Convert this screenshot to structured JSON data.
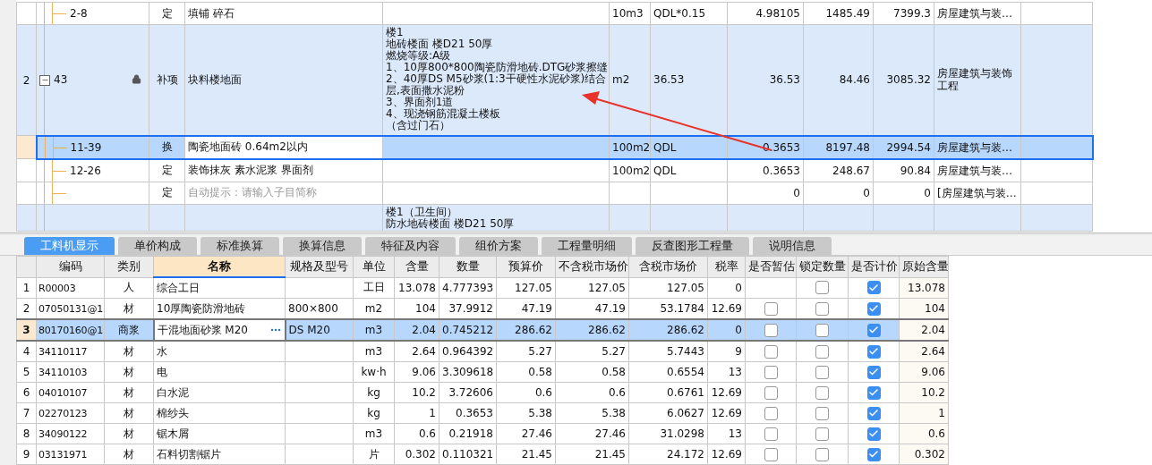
{
  "top_table": {
    "rows": [
      {
        "children": [
          {
            "code": "2-8",
            "type": "定",
            "name": "填铺 碎石",
            "unit": "10m3",
            "expression": "QDL*0.15",
            "quantity": "4.98105",
            "unit_price": "1485.49",
            "total": "7399.3",
            "specialty": "房屋建筑与装…",
            "selected": false
          }
        ]
      },
      {
        "seq": "2",
        "code": "43",
        "expanded": true,
        "locked": true,
        "type": "补项",
        "name": "块料楼地面",
        "features": [
          "楼1",
          "地砖楼面 楼D21 50厚",
          "燃烧等级:A级",
          "1、10厚800*800陶瓷防滑地砖.DTG砂浆擦缝",
          "2、40厚DS M5砂浆(1:3干硬性水泥砂浆)结合",
          "层,表面撒水泥粉",
          "3、界面剂1道",
          "4、现浇钢筋混凝土楼板",
          "（含过门石）"
        ],
        "unit": "m2",
        "expression": "36.53",
        "quantity": "36.53",
        "unit_price": "84.46",
        "total": "3085.32",
        "specialty": "房屋建筑与装饰工程",
        "selected": false,
        "children": [
          {
            "code": "11-39",
            "type": "换",
            "name": "陶瓷地面砖 0.64m2以内",
            "unit": "100m2",
            "expression": "QDL",
            "quantity": "0.3653",
            "unit_price": "8197.48",
            "total": "2994.54",
            "specialty": "房屋建筑与装…",
            "selected": true
          },
          {
            "code": "12-26",
            "type": "定",
            "name": "装饰抹灰 素水泥浆 界面剂",
            "unit": "100m2",
            "expression": "QDL",
            "quantity": "0.3653",
            "unit_price": "248.67",
            "total": "90.84",
            "specialty": "房屋建筑与装…",
            "selected": false
          },
          {
            "type": "定",
            "placeholder": "自动提示：请输入子目简称",
            "quantity": "0",
            "unit_price": "0",
            "total": "0",
            "specialty": "[房屋建筑与装…",
            "selected": false
          }
        ]
      },
      {
        "features": [
          "楼1（卫生间）",
          "防水地砖楼面 楼D21 50厚"
        ],
        "selected": false
      }
    ]
  },
  "tabs": [
    {
      "label": "工料机显示",
      "selected": true
    },
    {
      "label": "单价构成",
      "selected": false
    },
    {
      "label": "标准换算",
      "selected": false
    },
    {
      "label": "换算信息",
      "selected": false
    },
    {
      "label": "特征及内容",
      "selected": false
    },
    {
      "label": "组价方案",
      "selected": false
    },
    {
      "label": "工程量明细",
      "selected": false
    },
    {
      "label": "反查图形工程量",
      "selected": false
    },
    {
      "label": "说明信息",
      "selected": false
    }
  ],
  "resource_table": {
    "columns": [
      {
        "label": "编码",
        "selected": false
      },
      {
        "label": "类别",
        "selected": false
      },
      {
        "label": "名称",
        "selected": true
      },
      {
        "label": "规格及型号",
        "selected": false
      },
      {
        "label": "单位",
        "selected": false
      },
      {
        "label": "含量",
        "selected": false
      },
      {
        "label": "数量",
        "selected": false
      },
      {
        "label": "预算价",
        "selected": false
      },
      {
        "label": "不含税市场价",
        "selected": false
      },
      {
        "label": "含税市场价",
        "selected": false
      },
      {
        "label": "税率",
        "selected": false
      },
      {
        "label": "是否暂估",
        "selected": false
      },
      {
        "label": "锁定数量",
        "selected": false
      },
      {
        "label": "是否计价",
        "selected": false
      },
      {
        "label": "原始含量",
        "selected": false
      }
    ],
    "rows": [
      {
        "num": "1",
        "code": "R00003",
        "type": "人",
        "name": "综合工日",
        "spec": "",
        "unit": "工日",
        "content": "13.078",
        "quantity": "4.777393",
        "budget_price": "127.05",
        "price_ex_tax": "127.05",
        "price_inc_tax": "127.05",
        "tax_rate": "0",
        "locked": false,
        "priced": true,
        "original_content": "13.078",
        "selected": false
      },
      {
        "num": "2",
        "code": "07050131@1",
        "type": "材",
        "name": "10厚陶瓷防滑地砖",
        "spec": "800×800",
        "unit": "m2",
        "content": "104",
        "quantity": "37.9912",
        "budget_price": "47.19",
        "price_ex_tax": "47.19",
        "price_inc_tax": "53.1784",
        "tax_rate": "12.69",
        "provisional": false,
        "locked": false,
        "priced": true,
        "original_content": "104",
        "selected": false
      },
      {
        "num": "3",
        "code": "80170160@1",
        "type": "商浆",
        "name": "干混地面砂浆 M20",
        "spec": "DS M20",
        "unit": "m3",
        "content": "2.04",
        "quantity": "0.745212",
        "budget_price": "286.62",
        "price_ex_tax": "286.62",
        "price_inc_tax": "286.62",
        "tax_rate": "0",
        "provisional": false,
        "locked": false,
        "priced": true,
        "original_content": "2.04",
        "selected": true
      },
      {
        "num": "4",
        "code": "34110117",
        "type": "材",
        "name": "水",
        "spec": "",
        "unit": "m3",
        "content": "2.64",
        "quantity": "0.964392",
        "budget_price": "5.27",
        "price_ex_tax": "5.27",
        "price_inc_tax": "5.7443",
        "tax_rate": "9",
        "provisional": false,
        "locked": false,
        "priced": true,
        "original_content": "2.64",
        "selected": false
      },
      {
        "num": "5",
        "code": "34110103",
        "type": "材",
        "name": "电",
        "spec": "",
        "unit": "kw·h",
        "content": "9.06",
        "quantity": "3.309618",
        "budget_price": "0.58",
        "price_ex_tax": "0.58",
        "price_inc_tax": "0.6554",
        "tax_rate": "13",
        "provisional": false,
        "locked": false,
        "priced": true,
        "original_content": "9.06",
        "selected": false
      },
      {
        "num": "6",
        "code": "04010107",
        "type": "材",
        "name": "白水泥",
        "spec": "",
        "unit": "kg",
        "content": "10.2",
        "quantity": "3.72606",
        "budget_price": "0.6",
        "price_ex_tax": "0.6",
        "price_inc_tax": "0.6761",
        "tax_rate": "12.69",
        "provisional": false,
        "locked": false,
        "priced": true,
        "original_content": "10.2",
        "selected": false
      },
      {
        "num": "7",
        "code": "02270123",
        "type": "材",
        "name": "棉纱头",
        "spec": "",
        "unit": "kg",
        "content": "1",
        "quantity": "0.3653",
        "budget_price": "5.38",
        "price_ex_tax": "5.38",
        "price_inc_tax": "6.0627",
        "tax_rate": "12.69",
        "provisional": false,
        "locked": false,
        "priced": true,
        "original_content": "1",
        "selected": false
      },
      {
        "num": "8",
        "code": "34090122",
        "type": "材",
        "name": "锯木屑",
        "spec": "",
        "unit": "m3",
        "content": "0.6",
        "quantity": "0.21918",
        "budget_price": "27.46",
        "price_ex_tax": "27.46",
        "price_inc_tax": "31.0298",
        "tax_rate": "13",
        "provisional": false,
        "locked": false,
        "priced": true,
        "original_content": "0.6",
        "selected": false
      },
      {
        "num": "9",
        "code": "03131971",
        "type": "材",
        "name": "石料切割锯片",
        "spec": "",
        "unit": "片",
        "content": "0.302",
        "quantity": "0.110321",
        "budget_price": "21.45",
        "price_ex_tax": "21.45",
        "price_inc_tax": "24.172",
        "tax_rate": "12.69",
        "provisional": false,
        "locked": false,
        "priced": true,
        "original_content": "0.302",
        "selected": false
      }
    ]
  }
}
